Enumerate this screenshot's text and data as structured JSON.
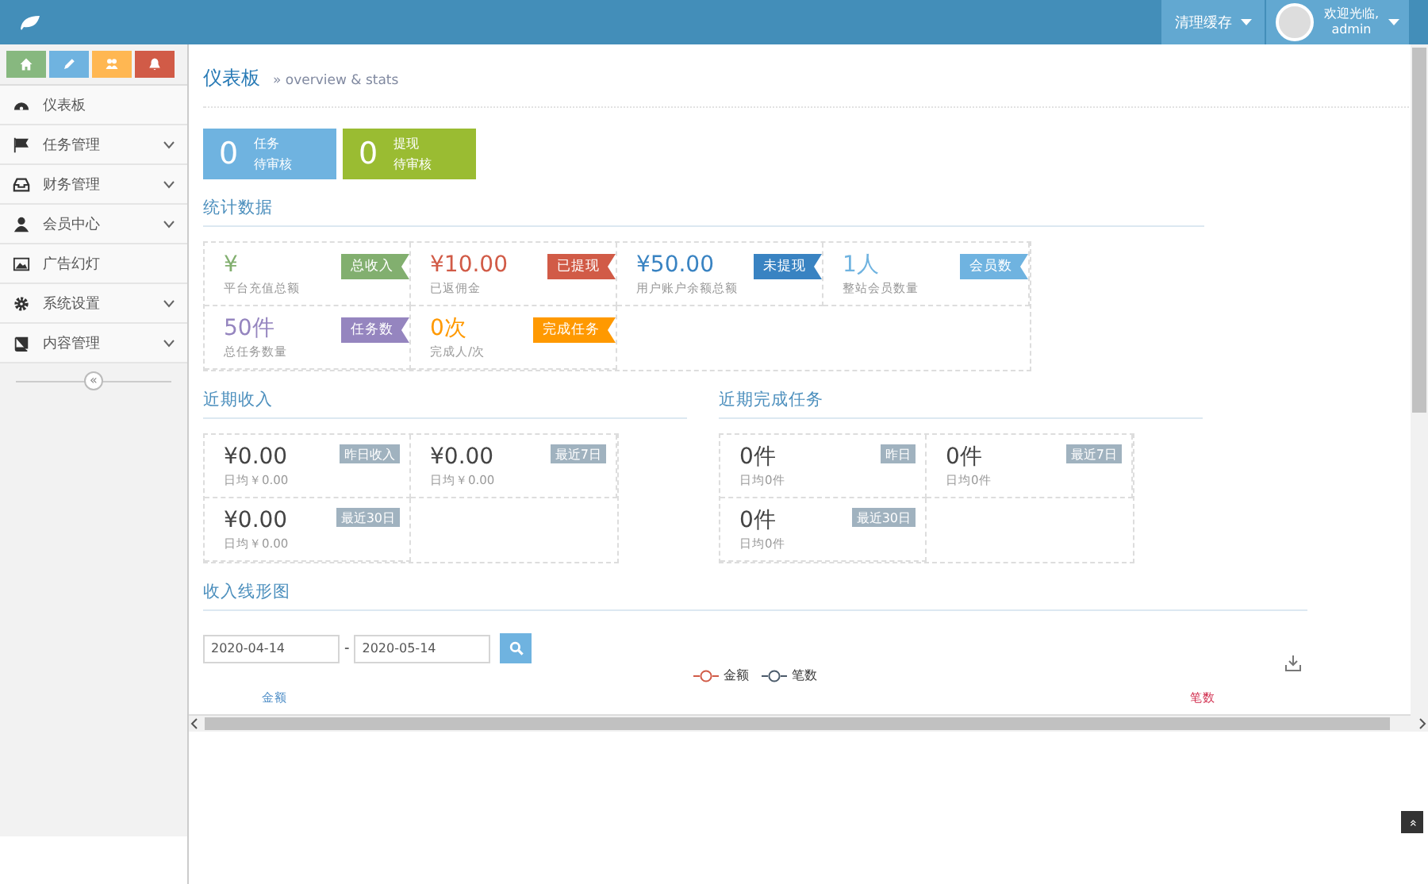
{
  "navbar": {
    "clear_cache": "清理缓存",
    "greeting": "欢迎光临,",
    "user": "admin"
  },
  "sidebar": {
    "shortcuts": [
      {
        "color": "#87b87f"
      },
      {
        "color": "#6fb3e0"
      },
      {
        "color": "#ffb752"
      },
      {
        "color": "#d15b47"
      }
    ],
    "items": [
      {
        "label": "仪表板",
        "has_submenu": false
      },
      {
        "label": "任务管理",
        "has_submenu": true
      },
      {
        "label": "财务管理",
        "has_submenu": true
      },
      {
        "label": "会员中心",
        "has_submenu": true
      },
      {
        "label": "广告幻灯",
        "has_submenu": false
      },
      {
        "label": "系统设置",
        "has_submenu": true
      },
      {
        "label": "内容管理",
        "has_submenu": true
      }
    ],
    "collapse": "«"
  },
  "page_header": {
    "title": "仪表板",
    "subtitle": "» overview & stats"
  },
  "infoboxes": [
    {
      "value": "0",
      "title": "任务",
      "subtitle": "待审核",
      "color": "#6fb3e0"
    },
    {
      "value": "0",
      "title": "提现",
      "subtitle": "待审核",
      "color": "#9abc32"
    }
  ],
  "stats": {
    "title": "统计数据",
    "items": [
      {
        "value": "¥",
        "caption": "平台充值总额",
        "badge": "总收入",
        "color": "#82af6f"
      },
      {
        "value": "¥10.00",
        "caption": "已返佣金",
        "badge": "已提现",
        "color": "#d15b47"
      },
      {
        "value": "¥50.00",
        "caption": "用户账户余额总额",
        "badge": "未提现",
        "color": "#3983c2"
      },
      {
        "value": "1人",
        "caption": "整站会员数量",
        "badge": "会员数",
        "color": "#6fb3e0"
      },
      {
        "value": "50件",
        "caption": "总任务数量",
        "badge": "任务数",
        "color": "#9585bf"
      },
      {
        "value": "0次",
        "caption": "完成人/次",
        "badge": "完成任务",
        "color": "#ff9900"
      }
    ]
  },
  "recent_income": {
    "title": "近期收入",
    "items": [
      {
        "value": "¥0.00",
        "caption": "日均￥0.00",
        "badge": "昨日收入"
      },
      {
        "value": "¥0.00",
        "caption": "日均￥0.00",
        "badge": "最近7日"
      },
      {
        "value": "¥0.00",
        "caption": "日均￥0.00",
        "badge": "最近30日"
      }
    ]
  },
  "recent_tasks": {
    "title": "近期完成任务",
    "items": [
      {
        "value": "0件",
        "caption": "日均0件",
        "badge": "昨日"
      },
      {
        "value": "0件",
        "caption": "日均0件",
        "badge": "最近7日"
      },
      {
        "value": "0件",
        "caption": "日均0件",
        "badge": "最近30日"
      }
    ]
  },
  "chart_section": {
    "title": "收入线形图",
    "date_from": "2020-04-14",
    "separator": "-",
    "date_to": "2020-05-14",
    "legend": [
      {
        "label": "金额",
        "color": "#d15b47"
      },
      {
        "label": "笔数",
        "color": "#4a5a6a"
      }
    ],
    "left_axis": {
      "label": "金额",
      "color": "#4f8ec7"
    },
    "right_axis": {
      "label": "笔数",
      "color": "#d12f4f"
    }
  },
  "back_to_top": "»"
}
